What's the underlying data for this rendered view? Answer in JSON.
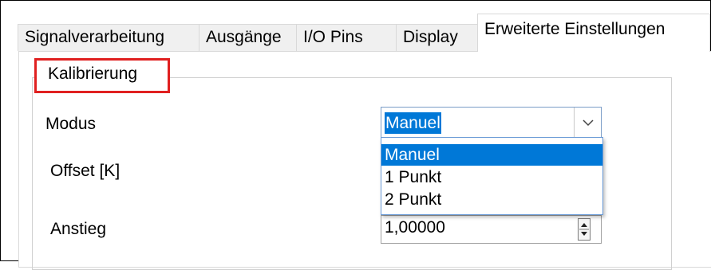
{
  "tabs": [
    {
      "label": "Signalverarbeitung",
      "active": false
    },
    {
      "label": "Ausgänge",
      "active": false
    },
    {
      "label": "I/O Pins",
      "active": false
    },
    {
      "label": "Display",
      "active": false
    },
    {
      "label": "Erweiterte Einstellungen",
      "active": true
    }
  ],
  "group": {
    "title": "Kalibrierung",
    "highlight_color": "#e02020"
  },
  "fields": {
    "modus": {
      "label": "Modus",
      "value": "Manuel",
      "options": [
        "Manuel",
        "1 Punkt",
        "2 Punkt"
      ],
      "selected_option": "Manuel"
    },
    "offset": {
      "label": "Offset [K]"
    },
    "anstieg": {
      "label": "Anstieg",
      "value": "1,00000"
    }
  },
  "colors": {
    "selection": "#0078d7",
    "accent_border": "#7a9cc7"
  },
  "icons": {
    "dropdown": "chevron-down-icon",
    "spinner": "spinner-up-down-icon"
  }
}
